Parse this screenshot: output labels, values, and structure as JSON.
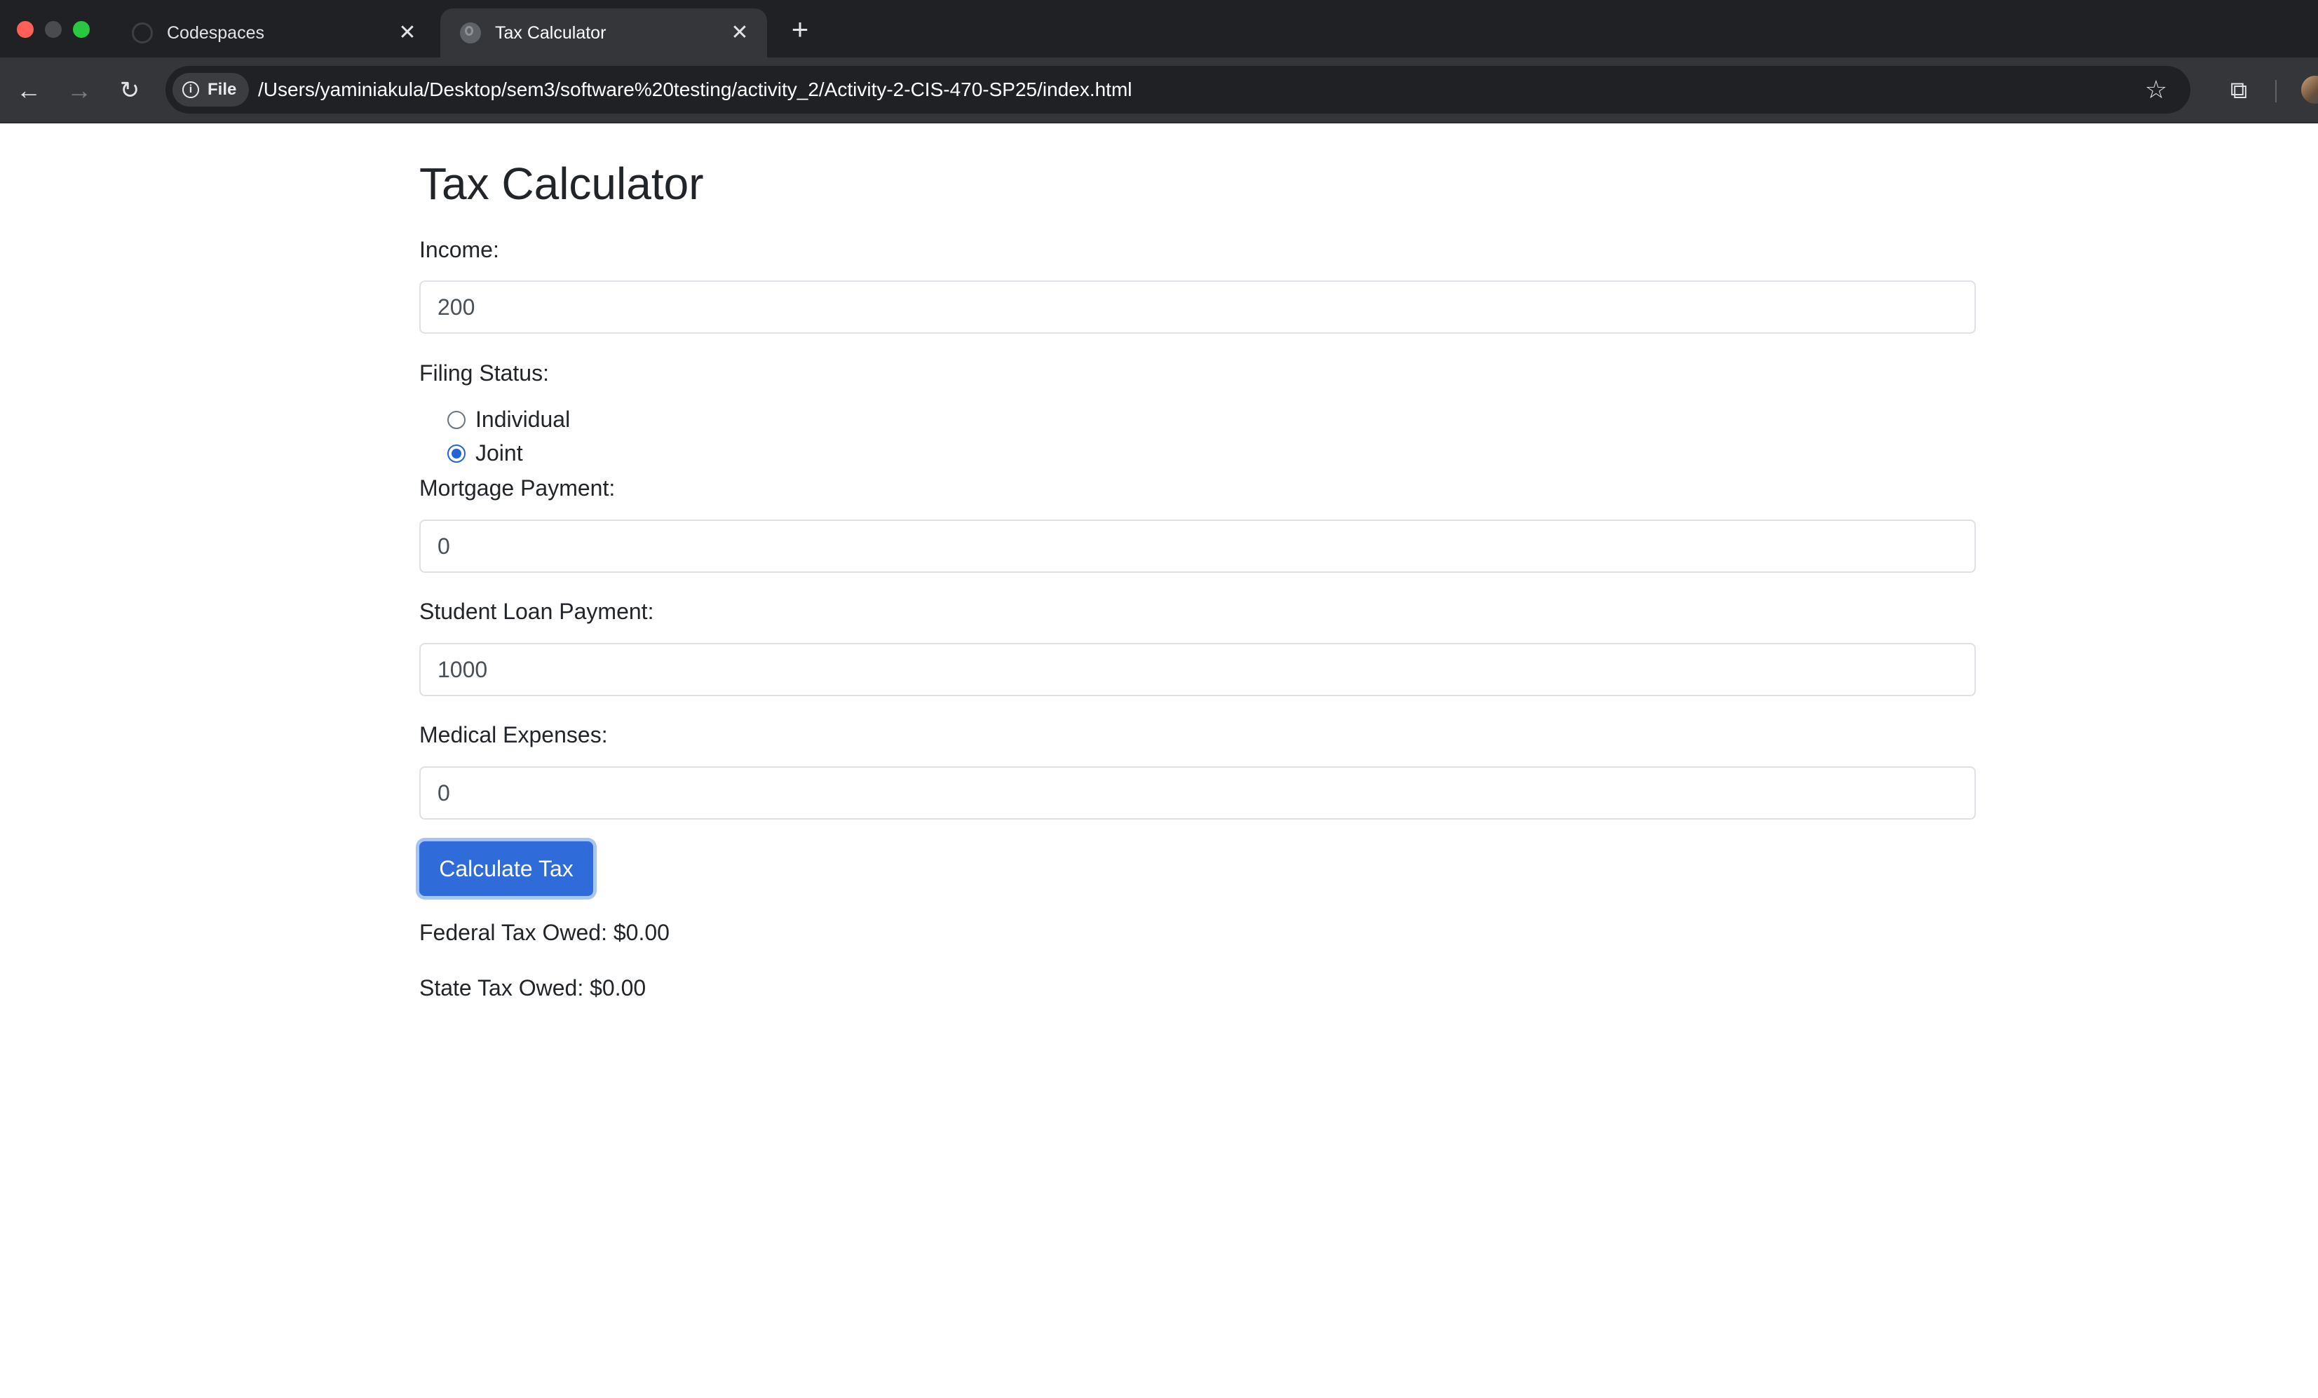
{
  "browser": {
    "tabs": [
      {
        "title": "Codespaces",
        "active": false,
        "favicon": "github-icon"
      },
      {
        "title": "Tax Calculator",
        "active": true,
        "favicon": "globe-icon"
      }
    ],
    "new_tab_label": "+",
    "tab_close_glyph": "✕",
    "security_chip_label": "File",
    "url": "/Users/yaminiakula/Desktop/sem3/software%20testing/activity_2/Activity-2-CIS-470-SP25/index.html",
    "icons": {
      "back": "←",
      "forward": "→",
      "reload": "↻",
      "info": "i",
      "star": "☆",
      "extensions": "⧉"
    }
  },
  "page": {
    "title": "Tax Calculator",
    "income": {
      "label": "Income:",
      "value": "200"
    },
    "filing_status": {
      "label": "Filing Status:",
      "options": [
        {
          "label": "Individual",
          "checked": false
        },
        {
          "label": "Joint",
          "checked": true
        }
      ]
    },
    "mortgage": {
      "label": "Mortgage Payment:",
      "value": "0"
    },
    "student_loan": {
      "label": "Student Loan Payment:",
      "value": "1000"
    },
    "medical": {
      "label": "Medical Expenses:",
      "value": "0"
    },
    "calculate_button": "Calculate Tax",
    "results": {
      "federal": "Federal Tax Owed: $0.00",
      "state": "State Tax Owed: $0.00"
    }
  },
  "colors": {
    "accent": "#2f6bd9",
    "radio_checked": "#2563d9",
    "text": "#212529"
  }
}
